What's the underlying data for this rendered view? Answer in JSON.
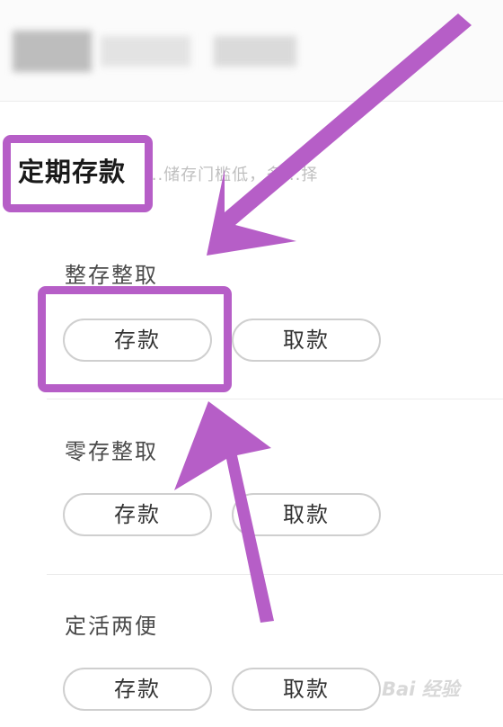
{
  "section": {
    "title": "定期存款",
    "hint": "...储存门槛低，多...择"
  },
  "groups": [
    {
      "label": "整存整取",
      "deposit_label": "存款",
      "withdraw_label": "取款"
    },
    {
      "label": "零存整取",
      "deposit_label": "存款",
      "withdraw_label": "取款"
    },
    {
      "label": "定活两便",
      "deposit_label": "存款",
      "withdraw_label": "取款"
    }
  ],
  "annotation": {
    "color": "#b65ec7"
  },
  "watermark": {
    "text": "Bai 经验"
  }
}
